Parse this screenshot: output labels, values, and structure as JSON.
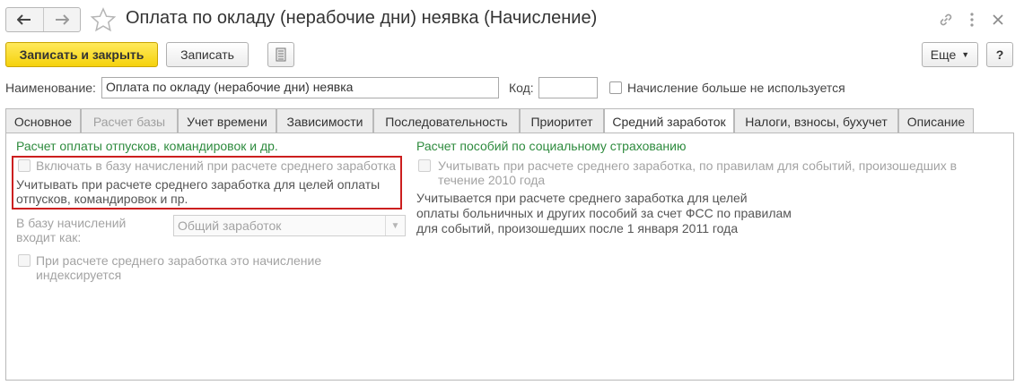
{
  "window": {
    "title": "Оплата по окладу (нерабочие дни) неявка (Начисление)",
    "nav_back_icon": "arrow-left-icon",
    "nav_forward_icon": "arrow-right-icon",
    "favorite_icon": "star-icon",
    "link_icon": "link-icon",
    "more_icon": "more-vertical-icon",
    "close_icon": "close-icon"
  },
  "toolbar": {
    "save_close_label": "Записать и закрыть",
    "save_label": "Записать",
    "report_icon": "document-icon",
    "more_label": "Еще",
    "help_label": "?"
  },
  "header": {
    "name_label": "Наименование:",
    "name_value": "Оплата по окладу (нерабочие дни) неявка",
    "code_label": "Код:",
    "code_value": "",
    "unused_label": "Начисление больше не используется"
  },
  "tabs": [
    {
      "label": "Основное"
    },
    {
      "label": "Расчет базы"
    },
    {
      "label": "Учет времени"
    },
    {
      "label": "Зависимости"
    },
    {
      "label": "Последовательность"
    },
    {
      "label": "Приоритет"
    },
    {
      "label": "Средний заработок"
    },
    {
      "label": "Налоги, взносы, бухучет"
    },
    {
      "label": "Описание"
    }
  ],
  "left_group": {
    "title": "Расчет оплаты отпусков, командировок и др.",
    "include_label": "Включать в базу начислений при расчете среднего заработка",
    "note_line1": "Учитывать при расчете среднего заработка для целей оплаты",
    "note_line2": "отпусков, командировок и пр.",
    "base_label_line1": "В базу начислений",
    "base_label_line2": "входит как:",
    "base_value": "Общий заработок",
    "indexed_line1": "При расчете среднего заработка это начисление",
    "indexed_line2": "индексируется"
  },
  "right_group": {
    "title": "Расчет пособий по социальному страхованию",
    "account_line1": "Учитывать при расчете среднего заработка, по правилам для событий, произошедших в",
    "account_line2": "течение 2010 года",
    "note_line1": "Учитывается при расчете среднего заработка для целей",
    "note_line2": "оплаты больничных и других пособий за счет ФСС по правилам",
    "note_line3": "для событий, произошедших после 1 января 2011 года"
  },
  "colors": {
    "primary_button": "#f5d20c",
    "group_title": "#2e8b3e",
    "highlight_border": "#cc1f1f"
  }
}
